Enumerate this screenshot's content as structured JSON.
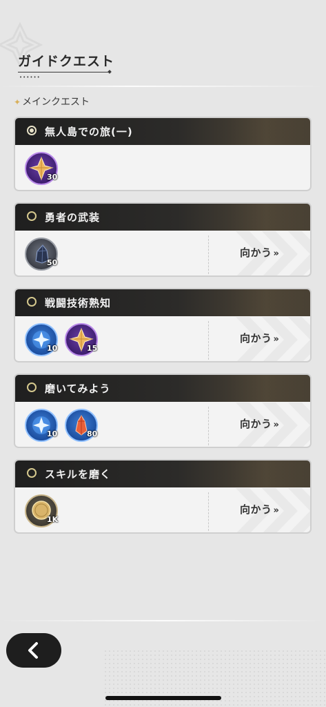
{
  "header": {
    "title": "ガイドクエスト",
    "dots": "••••••"
  },
  "section": {
    "sparkle": "✦",
    "label": "メインクエスト"
  },
  "quests": [
    {
      "title": "無人島での旅(一)",
      "status": "active",
      "rewards": [
        {
          "icon": "gold-crystal-icon",
          "count": "30",
          "frame": "purple"
        }
      ],
      "go_label": "",
      "go_arrows": ""
    },
    {
      "title": "勇者の武装",
      "status": "inactive",
      "rewards": [
        {
          "icon": "dark-ore-icon",
          "count": "50",
          "frame": "grey"
        }
      ],
      "go_label": "向かう",
      "go_arrows": "»"
    },
    {
      "title": "戦闘技術熟知",
      "status": "inactive",
      "rewards": [
        {
          "icon": "blue-star-orb-icon",
          "count": "10",
          "frame": "blue"
        },
        {
          "icon": "gold-crystal-icon",
          "count": "15",
          "frame": "purple"
        }
      ],
      "go_label": "向かう",
      "go_arrows": "»"
    },
    {
      "title": "磨いてみよう",
      "status": "inactive",
      "rewards": [
        {
          "icon": "blue-star-orb-icon",
          "count": "10",
          "frame": "blue"
        },
        {
          "icon": "red-crystal-icon",
          "count": "80",
          "frame": "blue"
        }
      ],
      "go_label": "向かう",
      "go_arrows": "»"
    },
    {
      "title": "スキルを磨く",
      "status": "inactive",
      "rewards": [
        {
          "icon": "gold-coin-icon",
          "count": "1K",
          "frame": "gold"
        }
      ],
      "go_label": "向かう",
      "go_arrows": "»"
    }
  ],
  "footer": {
    "back_icon": "chevron-left-icon"
  },
  "colors": {
    "header_dark": "#1f1f1f",
    "radio_ring": "#d6c98e",
    "background": "#e6e6e6"
  }
}
